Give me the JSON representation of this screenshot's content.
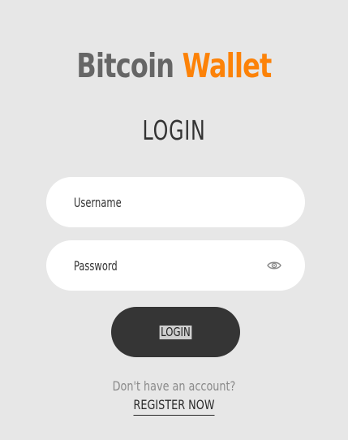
{
  "brand": {
    "part1": "Bitcoin",
    "part2": "Wallet",
    "color_part1": "#666666",
    "color_part2": "#fc8208"
  },
  "form": {
    "heading": "LOGIN",
    "username_placeholder": "Username",
    "username_value": "",
    "password_placeholder": "Password",
    "password_value": "",
    "password_toggle_icon": "eye-icon",
    "submit_label": "LOGIN"
  },
  "footer": {
    "prompt": "Don't have an account?",
    "register_label": "REGISTER NOW"
  },
  "colors": {
    "background": "#e7e7e7",
    "input_background": "#ffffff",
    "button_background": "#353535"
  }
}
